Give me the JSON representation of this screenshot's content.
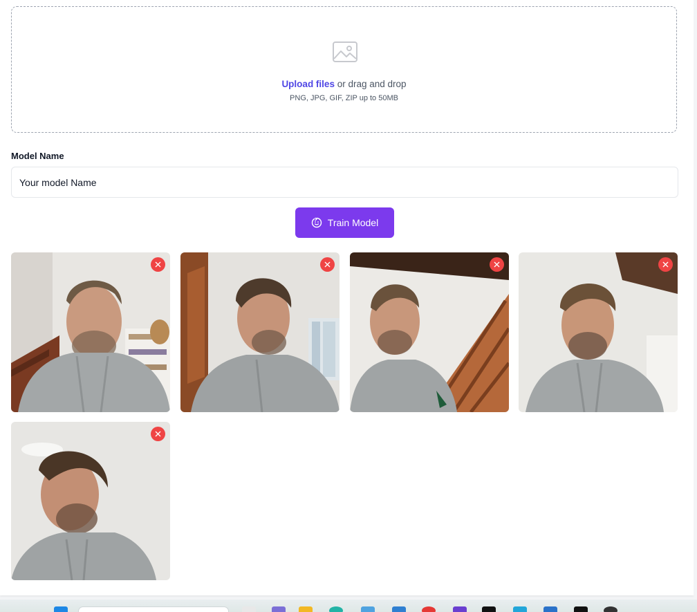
{
  "upload": {
    "link_label": "Upload files",
    "suffix": "or drag and drop",
    "hint": "PNG, JPG, GIF, ZIP up to 50MB",
    "icon": "image-icon"
  },
  "form": {
    "model_name_label": "Model Name",
    "model_name_value": "Your model Name"
  },
  "train_button": {
    "label": "Train Model",
    "icon": "face-smile-icon",
    "color": "#7c3aed"
  },
  "photos": [
    {
      "name": "photo-1",
      "remove_icon": "close-icon"
    },
    {
      "name": "photo-2",
      "remove_icon": "close-icon"
    },
    {
      "name": "photo-3",
      "remove_icon": "close-icon"
    },
    {
      "name": "photo-4",
      "remove_icon": "close-icon"
    },
    {
      "name": "photo-5",
      "remove_icon": "close-icon"
    }
  ],
  "colors": {
    "accent": "#4f46e5",
    "remove": "#ef4444"
  }
}
